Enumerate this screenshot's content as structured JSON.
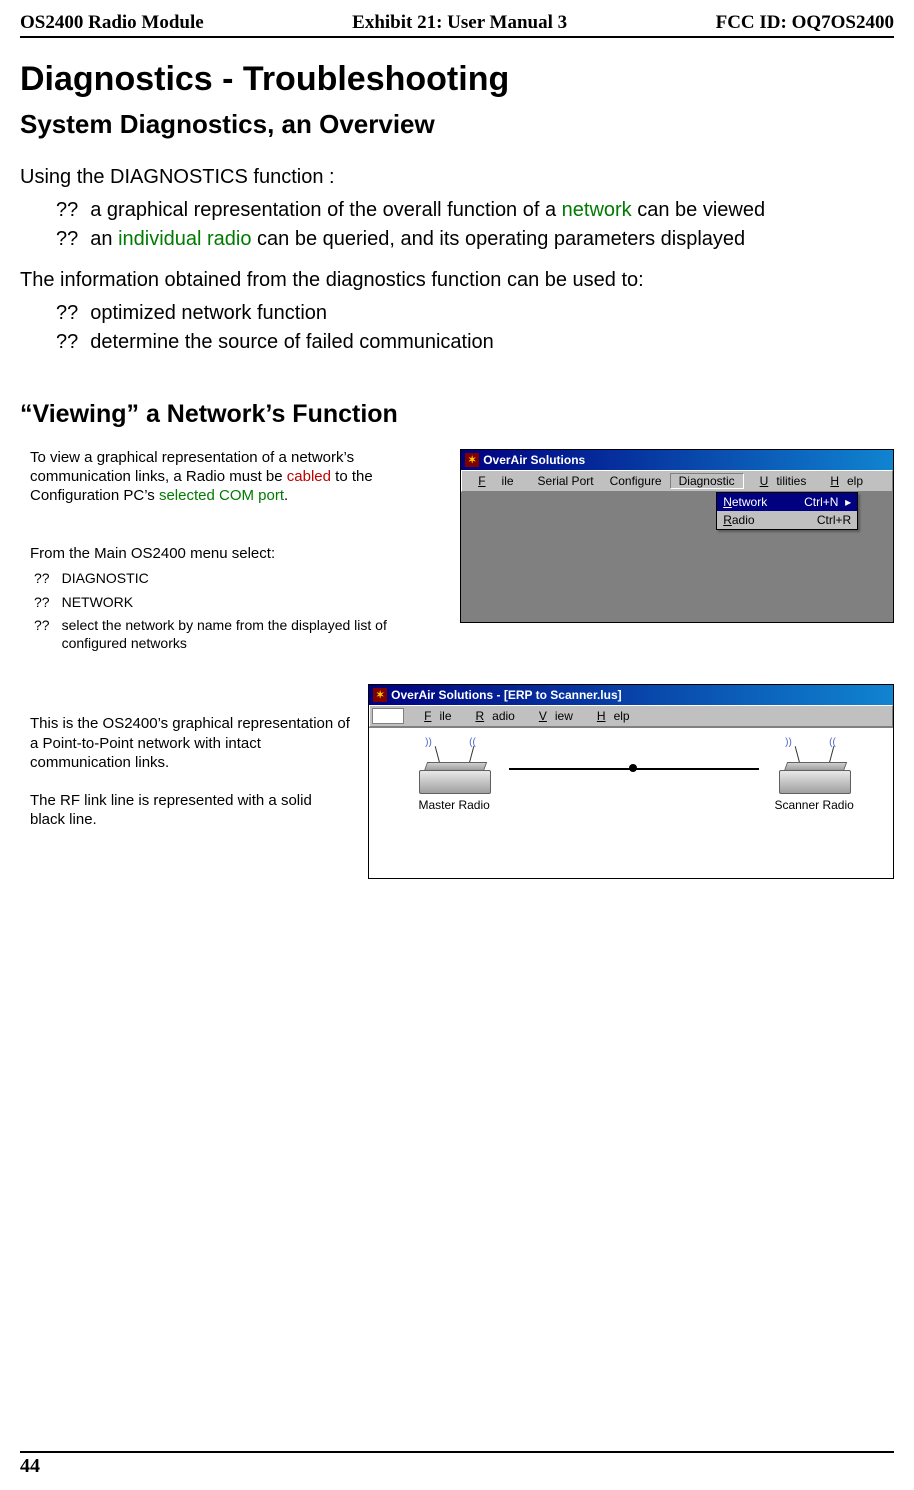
{
  "header": {
    "left": "OS2400 Radio Module",
    "center": "Exhibit 21: User Manual 3",
    "right": "FCC ID: OQ7OS2400"
  },
  "h1": "Diagnostics - Troubleshooting",
  "h2": "System Diagnostics, an Overview",
  "intro1": "Using the DIAGNOSTICS function :",
  "bullets1": {
    "b1_pre": "a graphical representation of the overall function of a ",
    "b1_green": "network",
    "b1_post": " can be  viewed",
    "b2_pre": "an ",
    "b2_green": "individual radio",
    "b2_post": " can be queried, and its operating parameters displayed"
  },
  "intro2": "The information obtained from the diagnostics function can be used to:",
  "bullets2": {
    "b1": "optimized network function",
    "b2": "determine the source of failed communication"
  },
  "sec2_title": "“Viewing” a Network’s Function",
  "para1_pre": "To view a graphical representation of a network’s communication links, a Radio must be ",
  "para1_red": "cabled",
  "para1_mid": " to the Configuration PC’s ",
  "para1_green": "selected COM port",
  "para1_end": ".",
  "para2": "From the Main OS2400 menu select:",
  "steps": {
    "s1": "DIAGNOSTIC",
    "s2": "NETWORK",
    "s3": "select the network by name from the displayed list of configured networks"
  },
  "para3": "This is the OS2400’s graphical representation of a Point-to-Point network with intact communication links.",
  "para4": "The RF link line is  represented with a solid black line.",
  "win1": {
    "title": "OverAir Solutions",
    "menu": {
      "file": "File",
      "serial": "Serial Port",
      "config": "Configure",
      "diag": "Diagnostic",
      "util": "Utilities",
      "help": "Help"
    },
    "dd": {
      "r1l": "Network",
      "r1r": "Ctrl+N",
      "arrow": "▸",
      "r2l": "Radio",
      "r2r": "Ctrl+R"
    }
  },
  "win2": {
    "title": "OverAir Solutions - [ERP to Scanner.lus]",
    "menu": {
      "file": "File",
      "radio": "Radio",
      "view": "View",
      "help": "Help"
    },
    "label1": "Master Radio",
    "label2": "Scanner Radio"
  },
  "qq": "??",
  "page_num": "44"
}
